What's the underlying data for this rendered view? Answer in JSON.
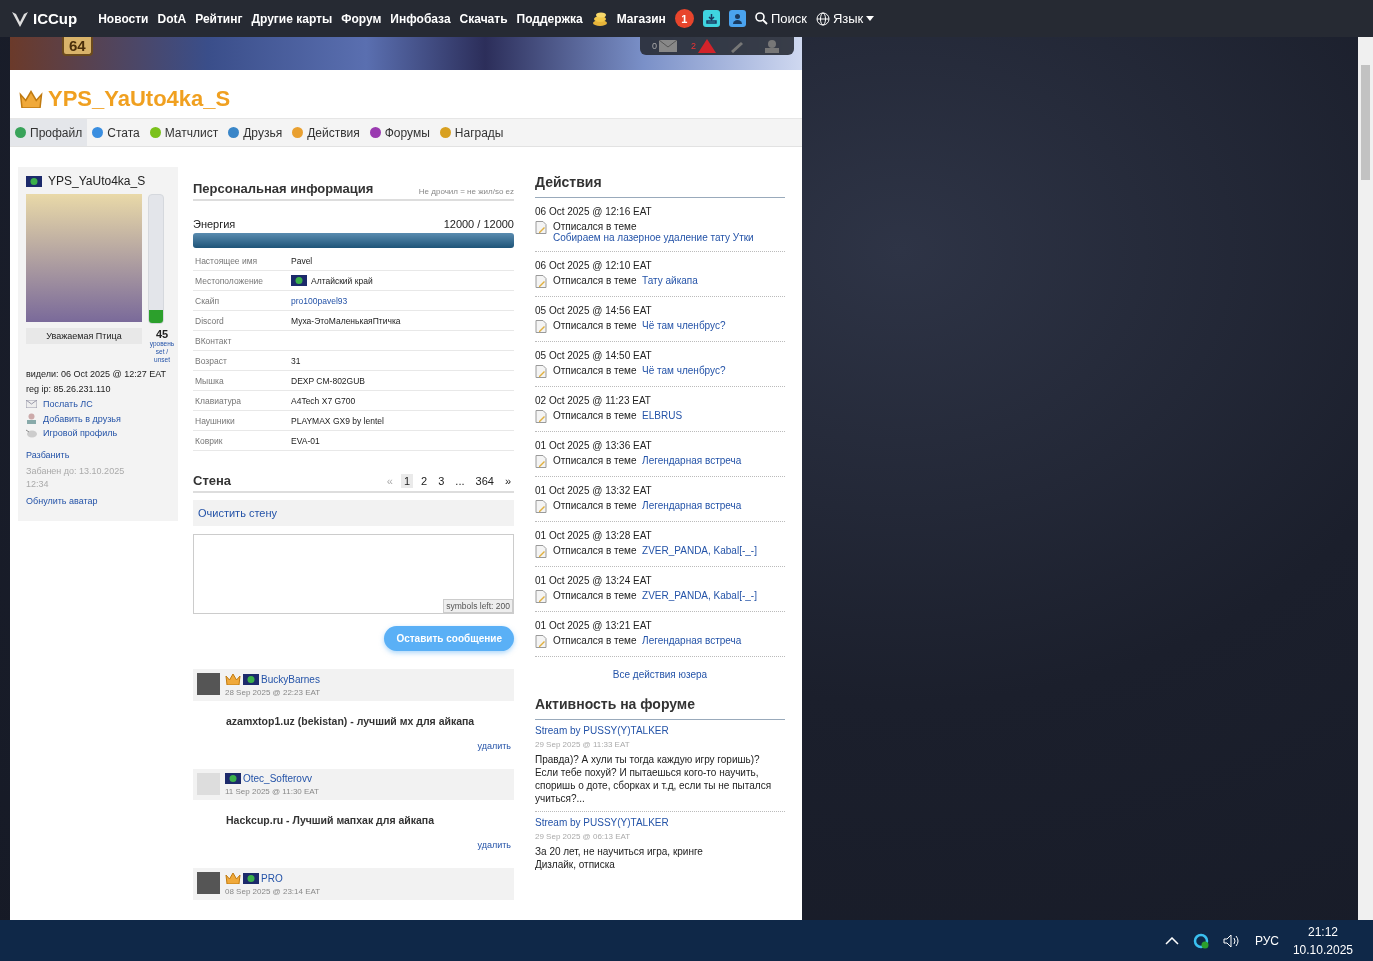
{
  "nav": {
    "logo": "ICCup",
    "links": [
      "Новости",
      "DotA",
      "Рейтинг",
      "Другие карты",
      "Форум",
      "Инфобаза",
      "Скачать",
      "Поддержка"
    ],
    "shop": "Магазин",
    "notifications": "1",
    "search": "Поиск",
    "language": "Язык"
  },
  "banner": {
    "badge": "64",
    "mail_count": "0",
    "alerts_count": "2"
  },
  "profile": {
    "title": "YPS_YaUto4ka_S",
    "tabs": [
      {
        "label": "Профайл",
        "selected": true
      },
      {
        "label": "Стата",
        "selected": false
      },
      {
        "label": "Матчлист",
        "selected": false
      },
      {
        "label": "Друзья",
        "selected": false
      },
      {
        "label": "Действия",
        "selected": false
      },
      {
        "label": "Форумы",
        "selected": false
      },
      {
        "label": "Награды",
        "selected": false
      }
    ]
  },
  "sidebar": {
    "name": "YPS_YaUto4ka_S",
    "rank": "Уважаемая Птица",
    "progress": {
      "level": 0.1
    },
    "level_value": "45",
    "level_caption": "уровень",
    "set_unset": "set / unset",
    "seen": "видели: 06 Oct 2025 @ 12:27 EAT",
    "reg_ip": "reg ip: 85.26.231.110",
    "links": [
      {
        "label": "Послать ЛС",
        "kind": "mail"
      },
      {
        "label": "Добавить в друзья",
        "kind": "friend"
      },
      {
        "label": "Игровой профиль",
        "kind": "game"
      }
    ],
    "unban": "Разбанить",
    "banned_until": "Забанен до: 13.10.2025 12:34",
    "reset_avatar": "Обнулить аватар"
  },
  "personal": {
    "title": "Персональная информация",
    "status": "Не дрочил = не жил/so ez",
    "energy": {
      "label": "Энергия",
      "reading": "12000 / 12000",
      "level": 1
    },
    "fields": [
      {
        "label": "Настоящее имя",
        "value": "Pavel",
        "kind": "text"
      },
      {
        "label": "Местоположение",
        "value": "Алтайский край",
        "kind": "flag"
      },
      {
        "label": "Скайп",
        "value": "pro100pavel93",
        "kind": "link"
      },
      {
        "label": "Discord",
        "value": "Муха-ЭтоМаленькаяПтичка",
        "kind": "text"
      },
      {
        "label": "ВКонтакт"
      },
      {
        "label": "Возраст",
        "value": "31",
        "kind": "text"
      },
      {
        "label": "Мышка",
        "value": "DEXP CM-802GUB",
        "kind": "text"
      },
      {
        "label": "Клавиатура",
        "value": "A4Tech X7 G700",
        "kind": "text"
      },
      {
        "label": "Наушники",
        "value": "PLAYMAX GX9 by lentel",
        "kind": "text"
      },
      {
        "label": "Коврик",
        "value": "EVA-01",
        "kind": "text"
      }
    ]
  },
  "wall": {
    "title": "Стена",
    "prev": "«",
    "pages": [
      {
        "label": "1",
        "selected": true
      },
      {
        "label": "2",
        "selected": false
      },
      {
        "label": "3",
        "selected": false
      },
      {
        "label": "...",
        "selected": false
      },
      {
        "label": "364",
        "selected": false
      }
    ],
    "next": "»",
    "clear": "Очистить стену",
    "counter": "symbols left: 200",
    "submit": "Оставить сообщение",
    "posts": [
      {
        "author": "BuckyBarnes",
        "crown": true,
        "date": "28 Sep 2025 @ 22:23 EAT",
        "text": "azamxtop1.uz (bekistan) - лучший мх для айкапа",
        "delete": "удалить"
      },
      {
        "author": "Otec_Softerovv",
        "crown": false,
        "date": "11 Sep 2025 @ 11:30 EAT",
        "text": "Hackcup.ru - Лучший мапхак для айкапа",
        "delete": "удалить"
      },
      {
        "author": "PRO",
        "crown": true,
        "date": "08 Sep 2025 @ 23:14 EAT"
      }
    ]
  },
  "actions": {
    "title": "Действия",
    "items": [
      {
        "date": "06 Oct 2025 @ 12:16 EAT",
        "verb": "Отписался в теме",
        "topic": "Собираем на лазерное удаление тату Утки"
      },
      {
        "date": "06 Oct 2025 @ 12:10 EAT",
        "verb": "Отписался в теме",
        "topic": "Тату айкапа"
      },
      {
        "date": "05 Oct 2025 @ 14:56 EAT",
        "verb": "Отписался в теме",
        "topic": "Чё там членбрус?"
      },
      {
        "date": "05 Oct 2025 @ 14:50 EAT",
        "verb": "Отписался в теме",
        "topic": "Чё там членбрус?"
      },
      {
        "date": "02 Oct 2025 @ 11:23 EAT",
        "verb": "Отписался в теме",
        "topic": "ELBRUS"
      },
      {
        "date": "01 Oct 2025 @ 13:36 EAT",
        "verb": "Отписался в теме",
        "topic": "Легендарная встреча"
      },
      {
        "date": "01 Oct 2025 @ 13:32 EAT",
        "verb": "Отписался в теме",
        "topic": "Легендарная встреча"
      },
      {
        "date": "01 Oct 2025 @ 13:28 EAT",
        "verb": "Отписался в теме",
        "topic": "ZVER_PANDA, Kabal[-_-]"
      },
      {
        "date": "01 Oct 2025 @ 13:24 EAT",
        "verb": "Отписался в теме",
        "topic": "ZVER_PANDA, Kabal[-_-]"
      },
      {
        "date": "01 Oct 2025 @ 13:21 EAT",
        "verb": "Отписался в теме",
        "topic": "Легендарная встреча"
      }
    ],
    "all_link": "Все действия юзера"
  },
  "forum": {
    "title": "Активность на форуме",
    "items": [
      {
        "topic": "Stream by PUSSY(Y)TALKER",
        "date": "29 Sep 2025 @ 11:33 EAT",
        "lines": [
          "Правда)? А хули ты тогда каждую игру горишь)? Если тебе похуй? И пытаешься кого-то научить, споришь о доте, сборках и т.д, если ты не пытался учиться?..."
        ]
      },
      {
        "topic": "Stream by PUSSY(Y)TALKER",
        "date": "29 Sep 2025 @ 06:13 EAT",
        "lines": [
          "За 20 лет, не научиться игра, кринге",
          "Дизлайк, отписка"
        ]
      }
    ]
  },
  "taskbar": {
    "language": "РУС",
    "time": "21:12",
    "date": "10.10.2025"
  }
}
